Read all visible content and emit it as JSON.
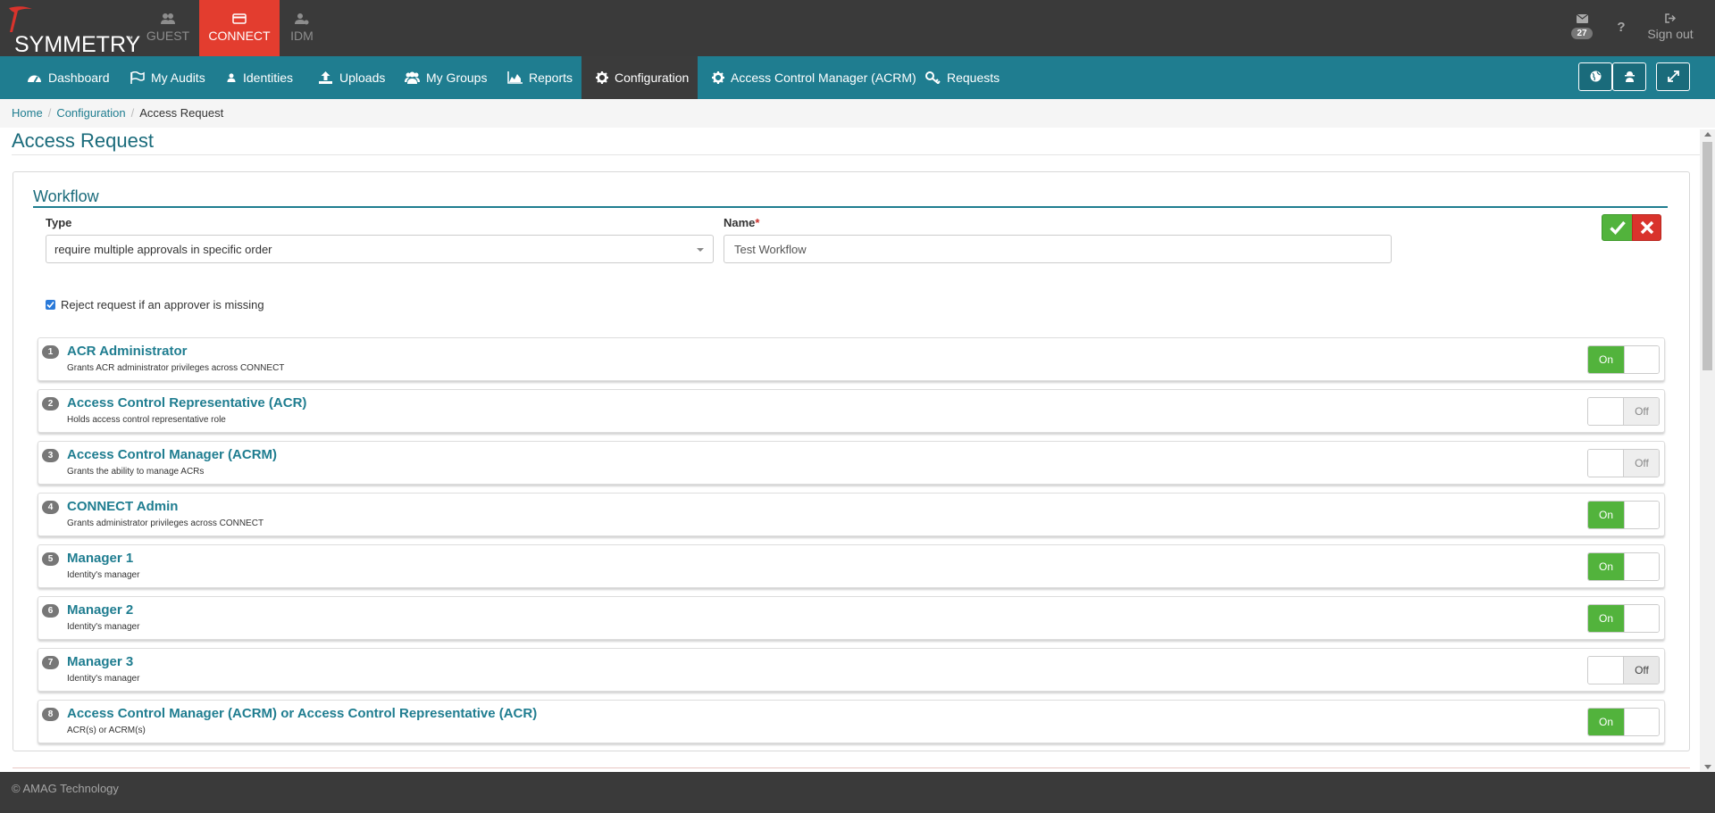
{
  "brand": {
    "name": "SYMMETRY",
    "tm": "™"
  },
  "app_tabs": [
    {
      "label": "GUEST",
      "icon": "users-icon"
    },
    {
      "label": "CONNECT",
      "icon": "card-icon",
      "active": true
    },
    {
      "label": "IDM",
      "icon": "user-gear-icon"
    }
  ],
  "top_right": {
    "mail_count": "27",
    "help": "?",
    "signout_label": "Sign out"
  },
  "nav": [
    {
      "label": "Dashboard",
      "icon": "dashboard-icon"
    },
    {
      "label": "My Audits",
      "icon": "flag-icon"
    },
    {
      "label": "Identities",
      "icon": "user-icon"
    },
    {
      "label": "Uploads",
      "icon": "upload-icon"
    },
    {
      "label": "My Groups",
      "icon": "users-icon"
    },
    {
      "label": "Reports",
      "icon": "area-chart-icon"
    },
    {
      "label": "Configuration",
      "icon": "gear-icon",
      "active": true
    },
    {
      "label": "Access Control Manager (ACRM)",
      "icon": "gear-icon"
    },
    {
      "label": "Requests",
      "icon": "key-icon"
    }
  ],
  "breadcrumb": {
    "home": "Home",
    "config": "Configuration",
    "current": "Access Request",
    "sep": "/"
  },
  "page_title": "Access Request",
  "workflow": {
    "section_title": "Workflow",
    "type_label": "Type",
    "type_value": "require multiple approvals in specific order",
    "name_label": "Name",
    "name_required": "*",
    "name_value": "Test Workflow",
    "reject_label": "Reject request if an approver is missing",
    "reject_checked": true
  },
  "approvers": [
    {
      "num": "1",
      "title": "ACR Administrator",
      "desc": "Grants ACR administrator privileges across CONNECT",
      "state": "On"
    },
    {
      "num": "2",
      "title": "Access Control Representative (ACR)",
      "desc": "Holds access control representative role",
      "state": "Off"
    },
    {
      "num": "3",
      "title": "Access Control Manager (ACRM)",
      "desc": "Grants the ability to manage ACRs",
      "state": "Off"
    },
    {
      "num": "4",
      "title": "CONNECT Admin",
      "desc": "Grants administrator privileges across CONNECT",
      "state": "On"
    },
    {
      "num": "5",
      "title": "Manager 1",
      "desc": "Identity's manager",
      "state": "On"
    },
    {
      "num": "6",
      "title": "Manager 2",
      "desc": "Identity's manager",
      "state": "On"
    },
    {
      "num": "7",
      "title": "Manager 3",
      "desc": "Identity's manager",
      "state": "Off"
    },
    {
      "num": "8",
      "title": "Access Control Manager (ACRM) or Access Control Representative (ACR)",
      "desc": "ACR(s) or ACRM(s)",
      "state": "On"
    }
  ],
  "colors": {
    "header_bg": "#3a3a3a",
    "nav_bg": "#1f7d90",
    "connect_red": "#e33d2f",
    "toggle_on": "#52b33c",
    "cancel_red": "#d9332c"
  },
  "footer": {
    "text": "© AMAG Technology"
  }
}
